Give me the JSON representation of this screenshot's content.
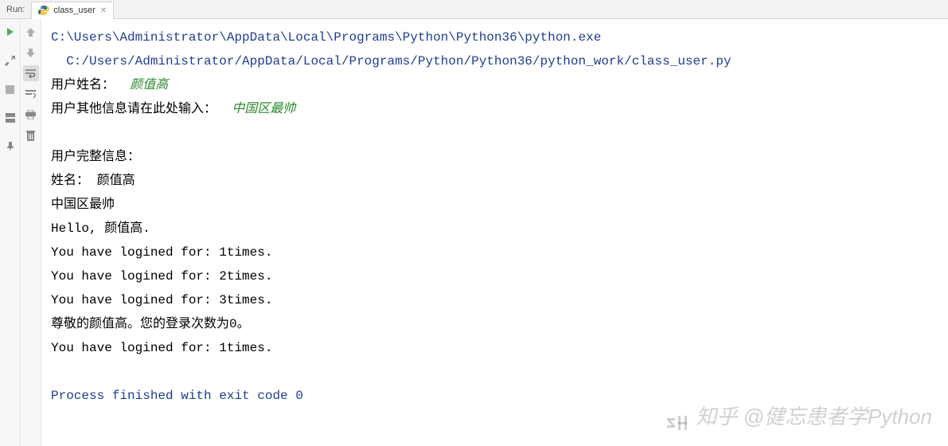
{
  "header": {
    "run_label": "Run:",
    "tab_name": "class_user"
  },
  "console": {
    "path_line1": "C:\\Users\\Administrator\\AppData\\Local\\Programs\\Python\\Python36\\python.exe",
    "path_line2": "  C:/Users/Administrator/AppData/Local/Programs/Python/Python36/python_work/class_user.py",
    "prompt1_label": "用户姓名：  ",
    "prompt1_input": "颜值高",
    "prompt2_label": "用户其他信息请在此处输入：  ",
    "prompt2_input": "中国区最帅",
    "blank": " ",
    "info_header": "用户完整信息：",
    "name_line": "姓名： 颜值高",
    "extra_line": "中国区最帅",
    "hello_line": "Hello, 颜值高.",
    "login1": "You have logined for: 1times.",
    "login2": "You have logined for: 2times.",
    "login3": "You have logined for: 3times.",
    "honor_line": "尊敬的颜值高。您的登录次数为0。",
    "login_again": "You have logined for: 1times.",
    "exit_line": "Process finished with exit code 0"
  },
  "watermark": "知乎 @健忘患者学Python"
}
